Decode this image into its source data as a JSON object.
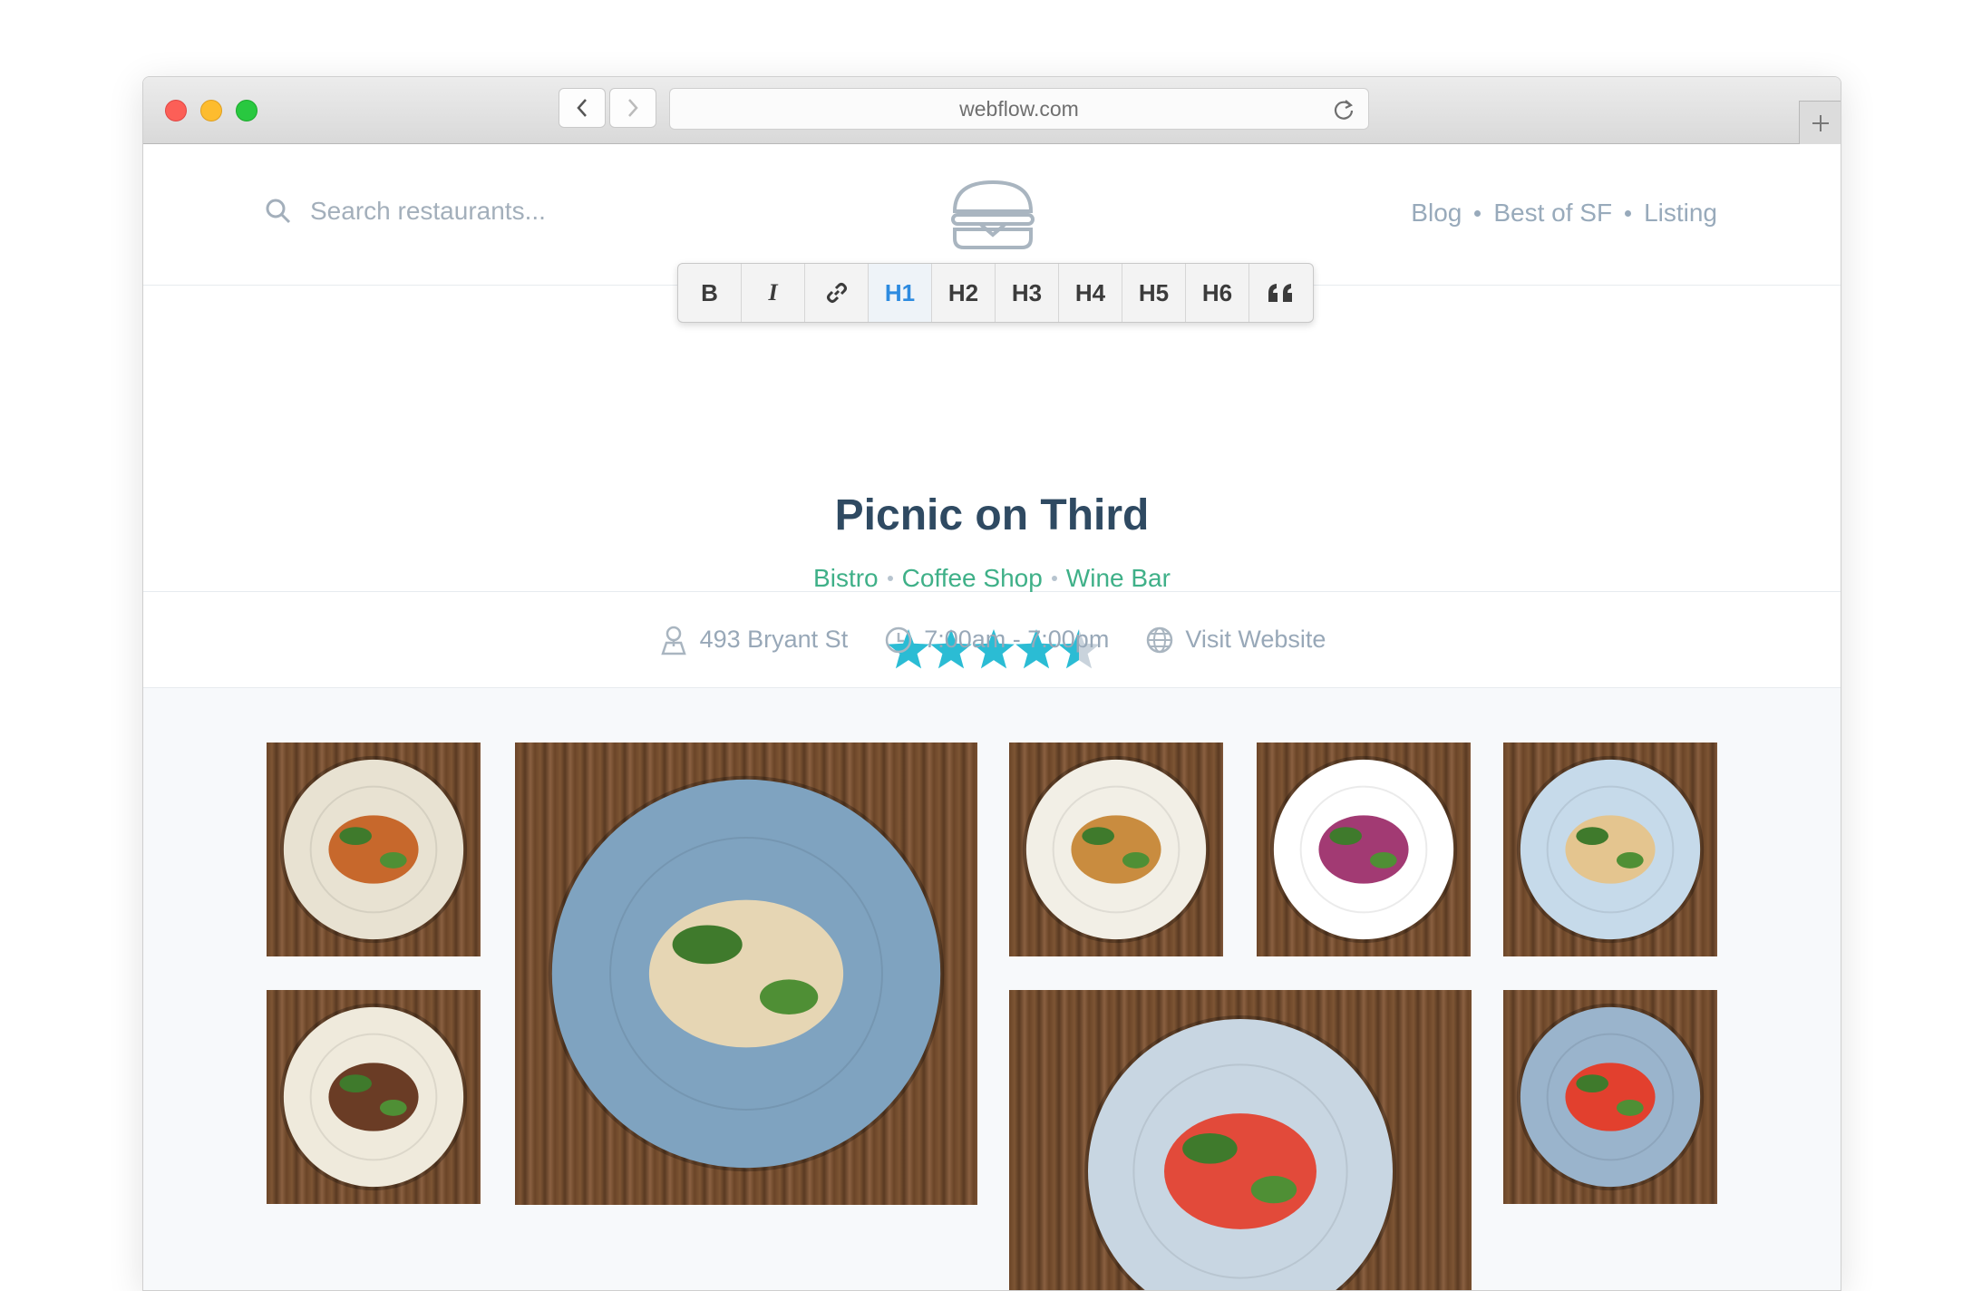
{
  "browser": {
    "url": "webflow.com"
  },
  "header": {
    "search_placeholder": "Search restaurants...",
    "nav": [
      "Blog",
      "Best of SF",
      "Listing"
    ]
  },
  "toolbar": {
    "buttons": [
      "B",
      "I",
      "",
      "H1",
      "H2",
      "H3",
      "H4",
      "H5",
      "H6",
      ""
    ],
    "active": "H1"
  },
  "restaurant": {
    "name": "Picnic on Third",
    "categories": [
      "Bistro",
      "Coffee Shop",
      "Wine Bar"
    ],
    "rating": 4.5,
    "rating_max": 5,
    "address": "493 Bryant St",
    "hours": "7:00am - 7:00pm",
    "website_label": "Visit Website"
  },
  "colors": {
    "accent_teal": "#2bbcd4",
    "category_green": "#3fb088",
    "title": "#2f4a62",
    "muted": "#98aabb",
    "active_toolbar": "#2d8be0"
  },
  "gallery": {
    "photos": [
      {
        "name": "roasted-carrots",
        "plate": "#e8e2d2",
        "food": "#c7682c"
      },
      {
        "name": "chicken-blue-plate",
        "plate": "#7fa3c0",
        "food": "#e6d6b4"
      },
      {
        "name": "salmon-asparagus",
        "plate": "#f2efe6",
        "food": "#c98c3f"
      },
      {
        "name": "pickled-cabbage",
        "plate": "#ffffff",
        "food": "#a23a73"
      },
      {
        "name": "fish-greens",
        "plate": "#c6daea",
        "food": "#e4c58f"
      },
      {
        "name": "meat-rice",
        "plate": "#efeadc",
        "food": "#6a3c25"
      },
      {
        "name": "gnocchi-tomato",
        "plate": "#c8d6e2",
        "food": "#e24a3a"
      },
      {
        "name": "tomato-egg",
        "plate": "#9ab4cc",
        "food": "#e2402e"
      }
    ]
  }
}
